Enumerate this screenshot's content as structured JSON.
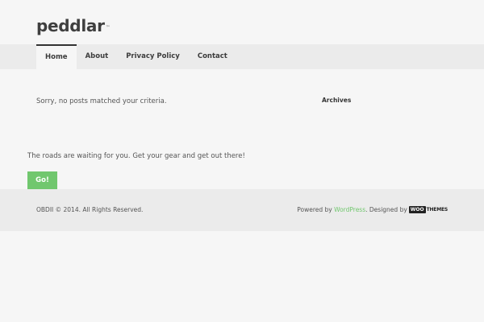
{
  "site": {
    "logo": "peddlar",
    "logo_mark": "™"
  },
  "nav": {
    "items": [
      {
        "label": "Home",
        "active": true
      },
      {
        "label": "About",
        "active": false
      },
      {
        "label": "Privacy Policy",
        "active": false
      },
      {
        "label": "Contact",
        "active": false
      }
    ]
  },
  "main": {
    "no_posts": "Sorry, no posts matched your criteria."
  },
  "sidebar": {
    "archives_title": "Archives"
  },
  "cta": {
    "text": "The roads are waiting for you. Get your gear and get out there!",
    "button": "Go!"
  },
  "footer": {
    "copyright": "OBDII © 2014. All Rights Reserved.",
    "powered_by": "Powered by",
    "wordpress": "WordPress",
    "designed_by": ". Designed by",
    "woo": "WOO",
    "themes": "THEMES"
  },
  "colors": {
    "accent": "#71c76e",
    "background": "#f6f6f6",
    "bar": "#ebebeb"
  }
}
